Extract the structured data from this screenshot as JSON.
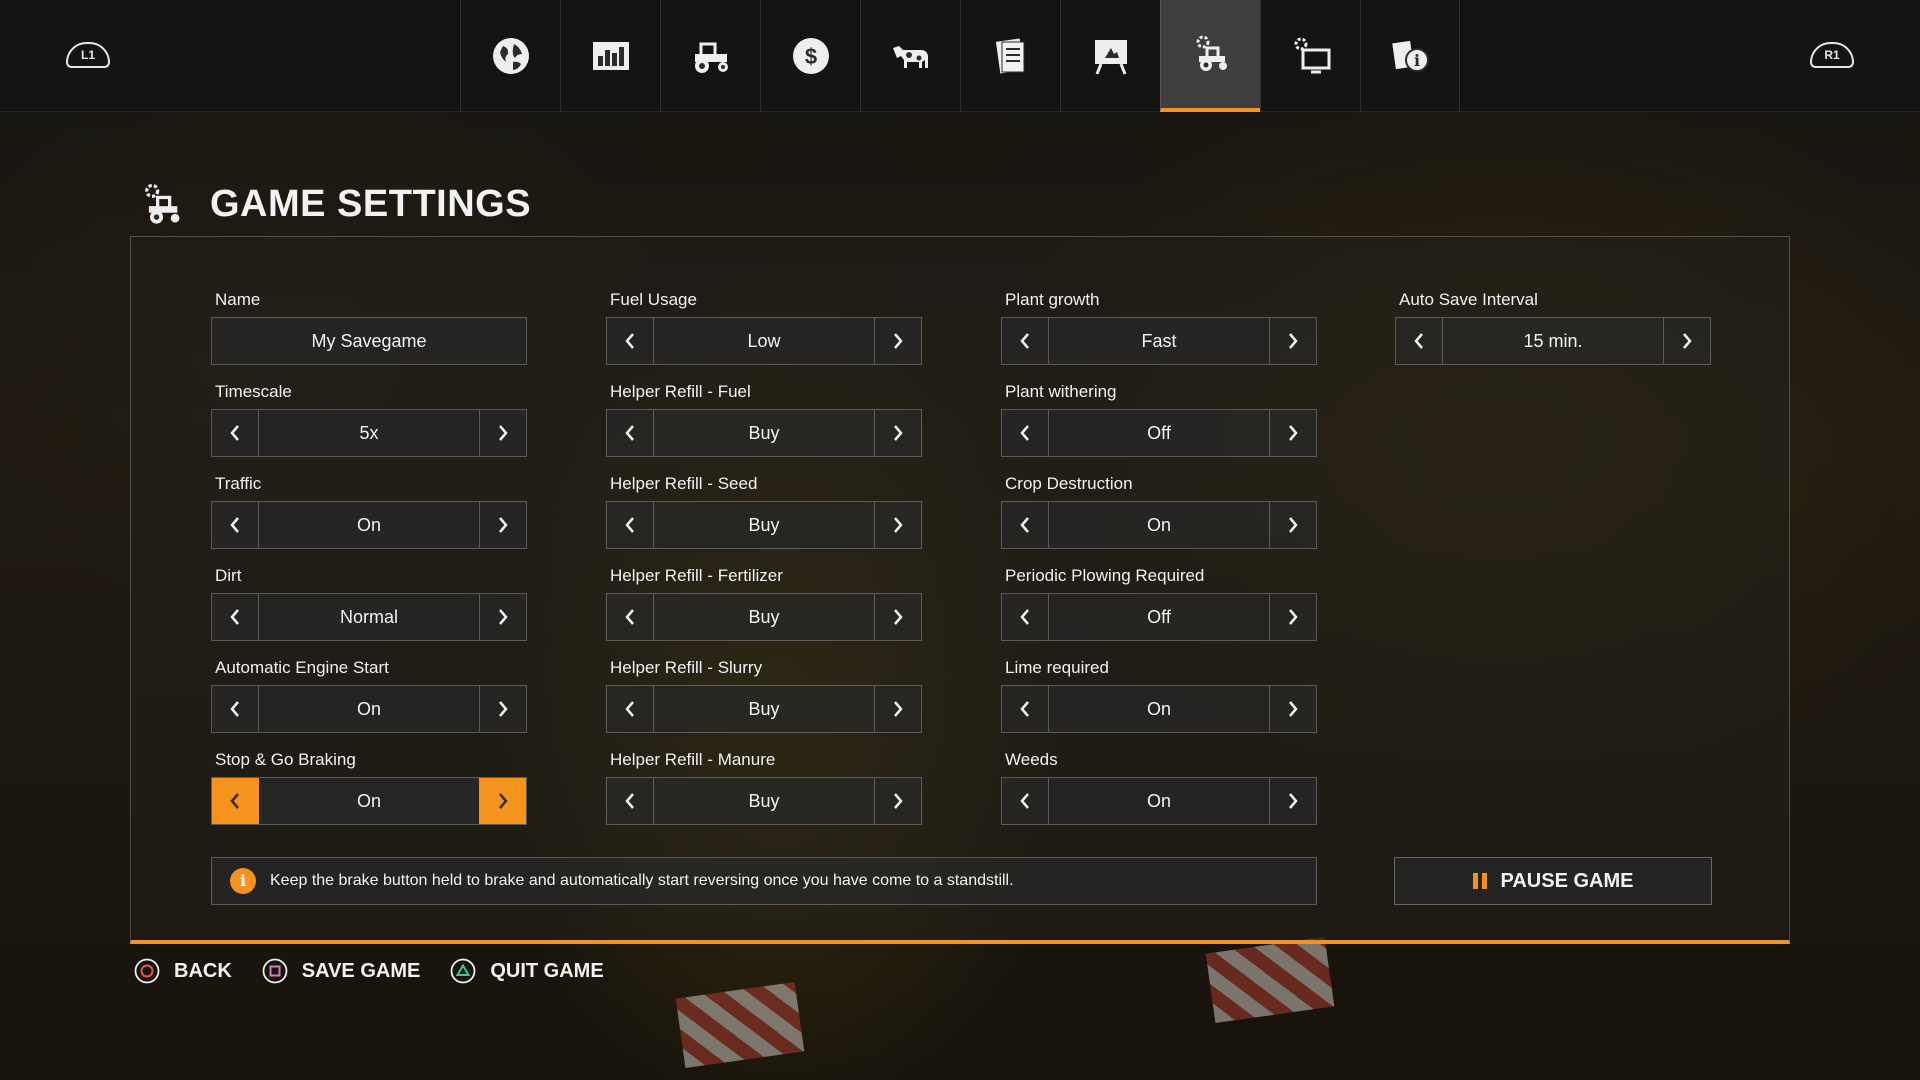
{
  "nav": {
    "left_shoulder": "L1",
    "right_shoulder": "R1",
    "tabs": [
      {
        "icon": "globe-icon"
      },
      {
        "icon": "stats-chart-icon"
      },
      {
        "icon": "tractor-icon"
      },
      {
        "icon": "dollar-icon"
      },
      {
        "icon": "cow-icon"
      },
      {
        "icon": "contracts-icon"
      },
      {
        "icon": "help-board-icon"
      },
      {
        "icon": "game-settings-icon",
        "active": true
      },
      {
        "icon": "display-settings-icon"
      },
      {
        "icon": "info-icon"
      }
    ],
    "accent": "#f5931e"
  },
  "page": {
    "title": "GAME SETTINGS"
  },
  "col1": [
    {
      "label": "Name",
      "value": "My Savegame"
    },
    {
      "label": "Timescale",
      "value": "5x"
    },
    {
      "label": "Traffic",
      "value": "On"
    },
    {
      "label": "Dirt",
      "value": "Normal"
    },
    {
      "label": "Automatic Engine Start",
      "value": "On"
    },
    {
      "label": "Stop & Go Braking",
      "value": "On"
    }
  ],
  "col2": [
    {
      "label": "Fuel Usage",
      "value": "Low"
    },
    {
      "label": "Helper Refill - Fuel",
      "value": "Buy"
    },
    {
      "label": "Helper Refill - Seed",
      "value": "Buy"
    },
    {
      "label": "Helper Refill - Fertilizer",
      "value": "Buy"
    },
    {
      "label": "Helper Refill - Slurry",
      "value": "Buy"
    },
    {
      "label": "Helper Refill - Manure",
      "value": "Buy"
    }
  ],
  "col3": [
    {
      "label": "Plant growth",
      "value": "Fast"
    },
    {
      "label": "Plant withering",
      "value": "Off"
    },
    {
      "label": "Crop Destruction",
      "value": "On"
    },
    {
      "label": "Periodic Plowing Required",
      "value": "Off"
    },
    {
      "label": "Lime required",
      "value": "On"
    },
    {
      "label": "Weeds",
      "value": "On"
    }
  ],
  "col4": [
    {
      "label": "Auto Save Interval",
      "value": "15 min."
    }
  ],
  "info": {
    "text": "Keep the brake button held to brake and automatically start reversing once you have come to a standstill."
  },
  "pause": {
    "label": "PAUSE GAME"
  },
  "footer": {
    "back": "BACK",
    "save": "SAVE GAME",
    "quit": "QUIT GAME"
  }
}
